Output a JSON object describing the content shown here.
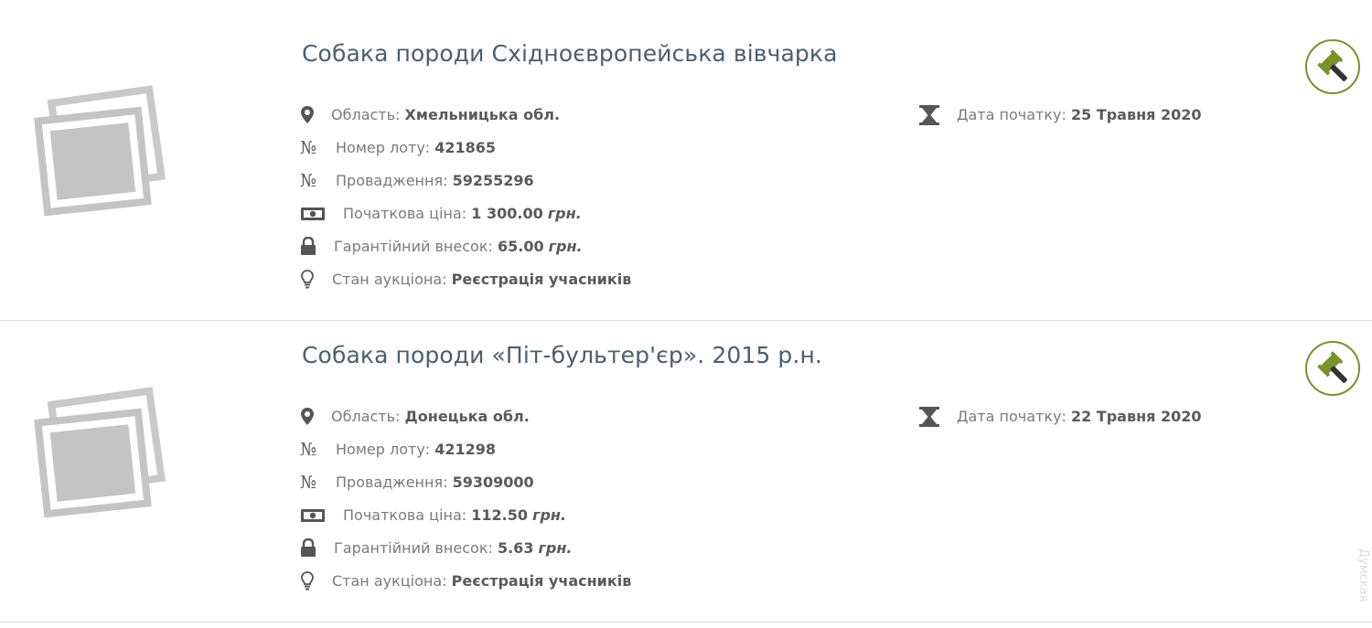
{
  "lots": [
    {
      "title": "Собака породи Східноєвропейська вівчарка",
      "region_label": "Область:",
      "region_value": "Хмельницька обл.",
      "lot_number_label": "Номер лоту:",
      "lot_number_value": "421865",
      "proceeding_label": "Провадження:",
      "proceeding_value": "59255296",
      "start_price_label": "Початкова ціна:",
      "start_price_value": "1 300.00",
      "start_price_currency": "грн.",
      "guarantee_label": "Гарантійний внесок:",
      "guarantee_value": "65.00",
      "guarantee_currency": "грн.",
      "status_label": "Стан аукціона:",
      "status_value": "Реєстрація учасників",
      "start_date_label": "Дата початку:",
      "start_date_value": "25 Травня 2020",
      "number_sign": "№"
    },
    {
      "title": "Собака породи «Піт-бультер'єр». 2015 р.н.",
      "region_label": "Область:",
      "region_value": "Донецька обл.",
      "lot_number_label": "Номер лоту:",
      "lot_number_value": "421298",
      "proceeding_label": "Провадження:",
      "proceeding_value": "59309000",
      "start_price_label": "Початкова ціна:",
      "start_price_value": "112.50",
      "start_price_currency": "грн.",
      "guarantee_label": "Гарантійний внесок:",
      "guarantee_value": "5.63",
      "guarantee_currency": "грн.",
      "status_label": "Стан аукціона:",
      "status_value": "Реєстрація учасників",
      "start_date_label": "Дата початку:",
      "start_date_value": "22 Травня 2020",
      "number_sign": "№"
    }
  ],
  "icons": {
    "region": "map-marker-icon",
    "lot_number": "number-sign-icon",
    "proceeding": "number-sign-icon",
    "start_price": "banknote-icon",
    "guarantee": "lock-icon",
    "status": "lightbulb-icon",
    "start_date": "hourglass-icon",
    "auction": "gavel-icon",
    "thumbnail": "image-placeholder-icon"
  },
  "colors": {
    "title": "#4a5f6d",
    "accent": "#77932b",
    "icon": "#555555",
    "divider": "#dcdcdc"
  },
  "watermark": "Думская"
}
